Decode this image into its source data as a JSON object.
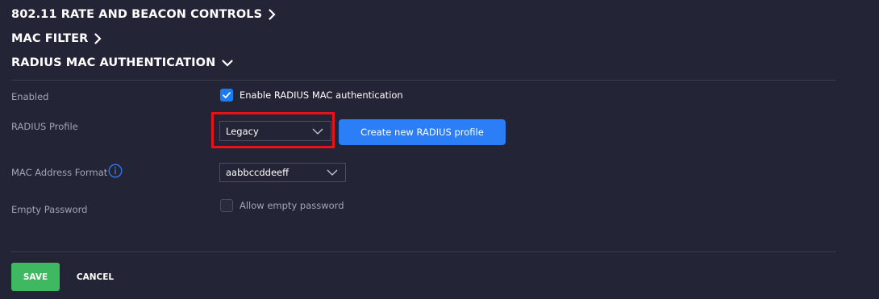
{
  "sections": {
    "rate_beacon": "802.11 RATE AND BEACON CONTROLS",
    "mac_filter": "MAC FILTER",
    "radius_mac_auth": "RADIUS MAC AUTHENTICATION"
  },
  "fields": {
    "enabled": {
      "label": "Enabled",
      "checkbox_label": "Enable RADIUS MAC authentication",
      "checked": true
    },
    "radius_profile": {
      "label": "RADIUS Profile",
      "value": "Legacy",
      "create_button": "Create new RADIUS profile"
    },
    "mac_address_format": {
      "label": "MAC Address Format",
      "value": "aabbccddeeff"
    },
    "empty_password": {
      "label": "Empty Password",
      "checkbox_label": "Allow empty password",
      "checked": false
    }
  },
  "actions": {
    "save": "SAVE",
    "cancel": "CANCEL"
  },
  "colors": {
    "background": "#232435",
    "accent_blue": "#2c7ef7",
    "save_green": "#3fb961",
    "highlight_red": "#e8121b"
  }
}
